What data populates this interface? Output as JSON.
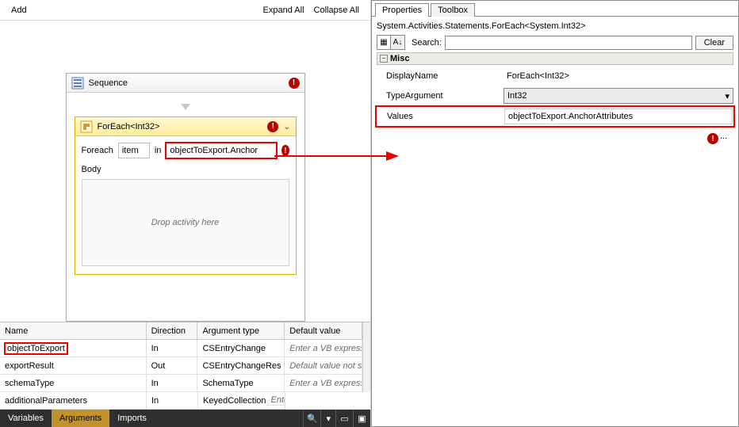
{
  "designer": {
    "toolbar": {
      "add": "Add",
      "expand": "Expand All",
      "collapse": "Collapse All"
    },
    "sequence": {
      "title": "Sequence"
    },
    "foreach": {
      "title": "ForEach<Int32>",
      "foreach_label": "Foreach",
      "item_var": "item",
      "in_label": "in",
      "values_expr": "objectToExport.Anchor",
      "body_label": "Body",
      "drop_hint": "Drop activity here"
    }
  },
  "args": {
    "headers": {
      "name": "Name",
      "direction": "Direction",
      "type": "Argument type",
      "default": "Default value"
    },
    "rows": [
      {
        "name": "objectToExport",
        "direction": "In",
        "type": "CSEntryChange",
        "default": "Enter a VB express",
        "highlight": true
      },
      {
        "name": "exportResult",
        "direction": "Out",
        "type": "CSEntryChangeRes",
        "default": "Default value not su"
      },
      {
        "name": "schemaType",
        "direction": "In",
        "type": "SchemaType",
        "default": "Enter a VB express"
      },
      {
        "name": "additionalParameters",
        "direction": "In",
        "type": "KeyedCollection<S",
        "default": "Enter a VB express"
      }
    ]
  },
  "bottomTabs": {
    "variables": "Variables",
    "arguments": "Arguments",
    "imports": "Imports"
  },
  "props": {
    "tab_properties": "Properties",
    "tab_toolbox": "Toolbox",
    "type_line": "System.Activities.Statements.ForEach<System.Int32>",
    "search_label": "Search:",
    "clear_label": "Clear",
    "cat_misc": "Misc",
    "rows": {
      "displayName": {
        "label": "DisplayName",
        "value": "ForEach<Int32>"
      },
      "typeArgument": {
        "label": "TypeArgument",
        "value": "Int32"
      },
      "values": {
        "label": "Values",
        "value": "objectToExport.AnchorAttributes"
      }
    }
  }
}
